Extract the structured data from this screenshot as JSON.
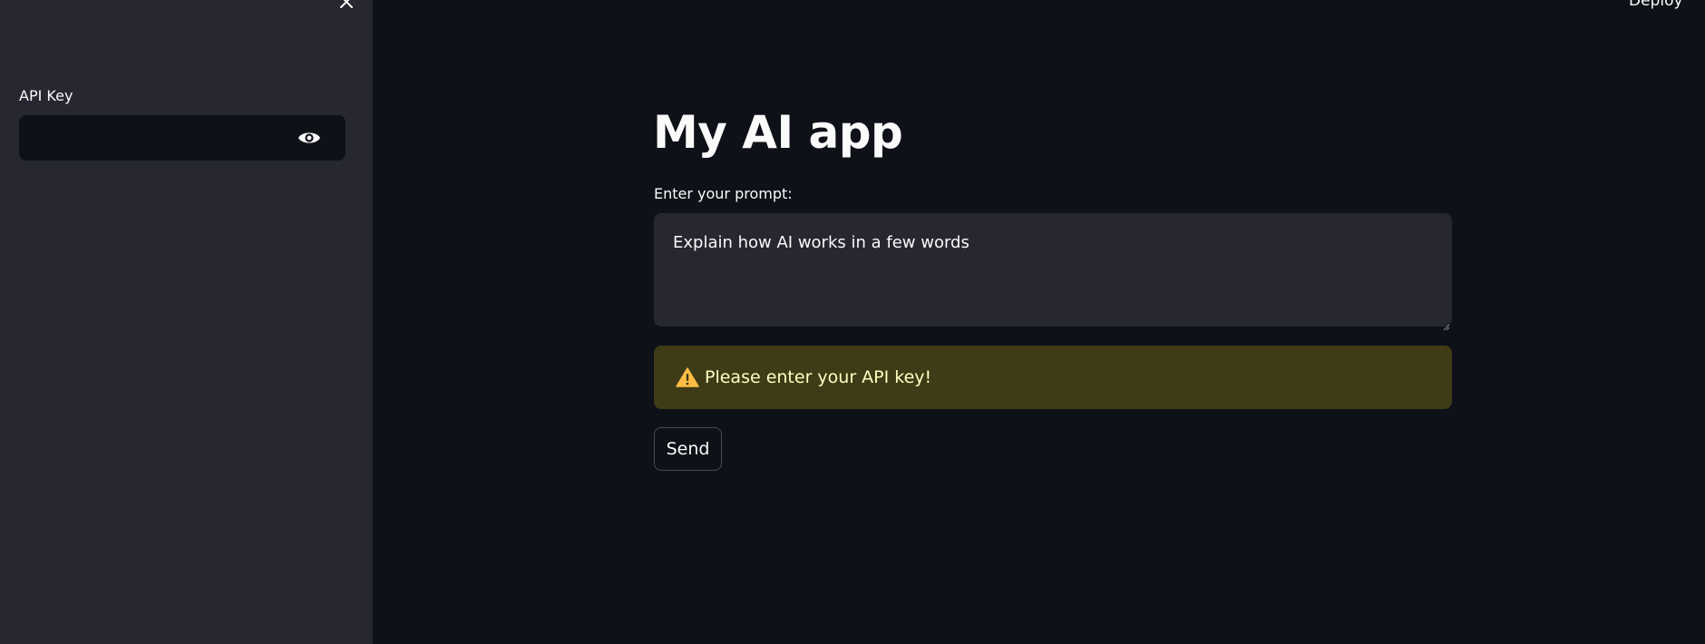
{
  "sidebar": {
    "api_key_label": "API Key",
    "api_key_value": "",
    "close_icon": "close-icon",
    "visibility_icon": "eye-icon"
  },
  "header": {
    "deploy_label": "Deploy"
  },
  "main": {
    "title": "My AI app",
    "prompt_label": "Enter your prompt:",
    "prompt_value": "Explain how AI works in a few words",
    "warning_icon": "warning-icon",
    "warning_text": "Please enter your API key!",
    "send_label": "Send"
  },
  "colors": {
    "background": "#0e1117",
    "sidebar": "#262730",
    "input": "#262730",
    "warning_bg": "#3e3b16",
    "warning_text": "#ffffc2",
    "warning_icon": "#ffbd45",
    "text": "#fafafa"
  }
}
